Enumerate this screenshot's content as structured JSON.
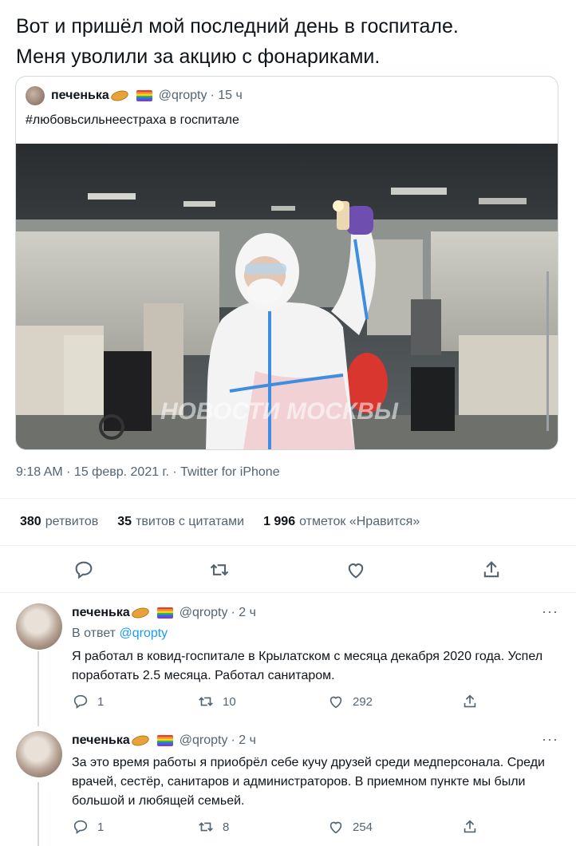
{
  "tweet": {
    "text_line1": "Вот и пришёл мой последний день в госпитале.",
    "text_line2": "Меня уволили за акцию с фонариками.",
    "meta": "9:18 AM · 15 февр. 2021 г. · Twitter for iPhone",
    "stats": [
      {
        "value": "380",
        "label": "ретвитов"
      },
      {
        "value": "35",
        "label": "твитов с цитатами"
      },
      {
        "value": "1 996",
        "label": "отметок «Нравится»"
      }
    ]
  },
  "quote": {
    "name": "печенька",
    "handle": "@qropty",
    "time": "· 15 ч",
    "text": "#любовьсильнеестраха в госпитале",
    "watermark": "НОВОСТИ МОСКВЫ"
  },
  "replies": [
    {
      "name": "печенька",
      "handle": "@qropty",
      "time": "· 2 ч",
      "in_reply_prefix": "В ответ",
      "in_reply_handle": "@qropty",
      "text": "Я работал в ковид-госпитале в Крылатском с месяца декабря 2020 года. Успел поработать 2.5 месяца. Работал санитаром.",
      "reply_count": "1",
      "retweet_count": "10",
      "like_count": "292"
    },
    {
      "name": "печенька",
      "handle": "@qropty",
      "time": "· 2 ч",
      "text": "За это время работы я приобрёл себе кучу друзей среди медперсонала. Среди врачей, сестёр, санитаров и администраторов. В приемном пункте мы были большой и любящей семьей.",
      "reply_count": "1",
      "retweet_count": "8",
      "like_count": "254"
    }
  ],
  "icons": {
    "more": "···"
  },
  "colors": {
    "accent": "#1d9bf0",
    "muted": "#536471",
    "border": "#cfd9de"
  }
}
